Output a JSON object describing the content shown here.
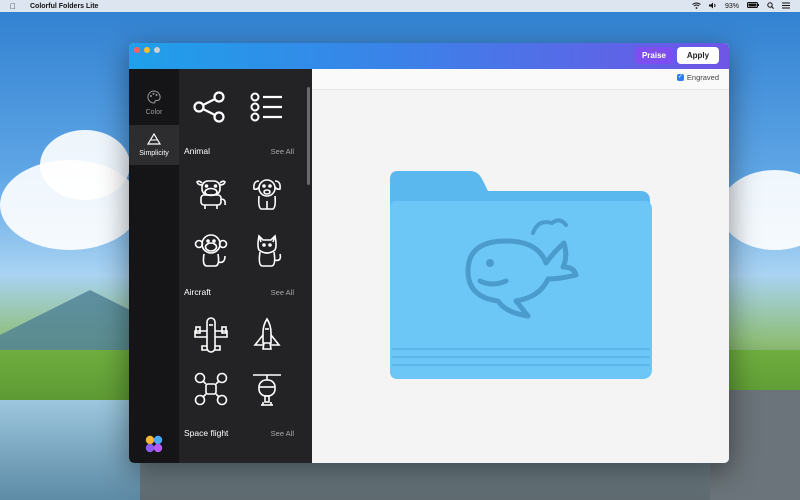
{
  "menubar": {
    "apple_icon": "apple-icon",
    "app_name": "Colorful Folders Lite",
    "battery": "93%",
    "icons": [
      "wifi-icon",
      "volume-icon",
      "battery-icon",
      "search-icon",
      "control-center-icon"
    ]
  },
  "window": {
    "praise_label": "Praise",
    "apply_label": "Apply",
    "accent_gradient": [
      "#1fa0ea",
      "#6f55e6"
    ]
  },
  "rail": {
    "items": [
      {
        "label": "Color",
        "icon": "palette-icon"
      },
      {
        "label": "Simplicity",
        "icon": "triangle-icon"
      }
    ],
    "logo": "app-logo-icon"
  },
  "panel": {
    "sections": [
      {
        "title": "Animal",
        "see_all": "See All",
        "icons": [
          "cow-icon",
          "dog-icon",
          "monkey-icon",
          "cat-icon"
        ]
      },
      {
        "title": "Aircraft",
        "see_all": "See All",
        "icons": [
          "airplane-icon",
          "shuttle-icon",
          "drone-icon",
          "helicopter-icon"
        ]
      },
      {
        "title": "Space flight",
        "see_all": "See All",
        "icons": []
      }
    ],
    "top_icons": [
      "share-icon",
      "list-icon"
    ]
  },
  "preview": {
    "engraved_label": "Engraved",
    "engraved_checked": true,
    "folder_color": "#69c4f5",
    "folder_icon": "whale-icon"
  }
}
